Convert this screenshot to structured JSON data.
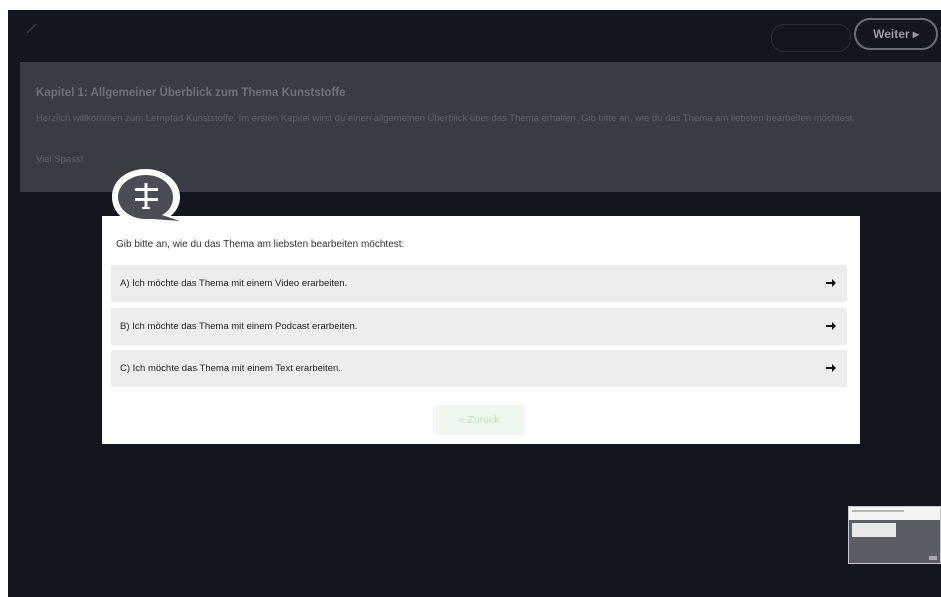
{
  "topbar": {
    "edit_icon": "pencil-icon",
    "back_label": "",
    "next_label": "Weiter ▸"
  },
  "chapter": {
    "title": "Kapitel 1: Allgemeiner Überblick zum Thema Kunststoffe",
    "intro": "Herzlich willkommen zum Lernpfad Kunststoffe. Im ersten Kapitel wirst du einen allgemeinen Überblick über das Thema erhalten. Gib bitte an, wie du das Thema am liebsten bearbeiten möchtest.",
    "closing": "Viel Spass!"
  },
  "dialog": {
    "icon": "signpost-icon",
    "question": "Gib bitte an, wie du das Thema am liebsten bearbeiten möchtest:",
    "options": [
      {
        "label": "A) Ich möchte das Thema mit einem Video erarbeiten."
      },
      {
        "label": "B) Ich möchte das Thema mit einem Podcast erarbeiten."
      },
      {
        "label": "C) Ich möchte das Thema mit einem Text erarbeiten."
      }
    ],
    "back_label": "« Zurück"
  },
  "colors": {
    "app_background": "#13161f",
    "chapter_panel": "#3a3c44",
    "dialog_background": "#ffffff",
    "option_background": "#ededed",
    "bubble": "#4a4d56",
    "zurueck_button": "#eef8ee"
  }
}
